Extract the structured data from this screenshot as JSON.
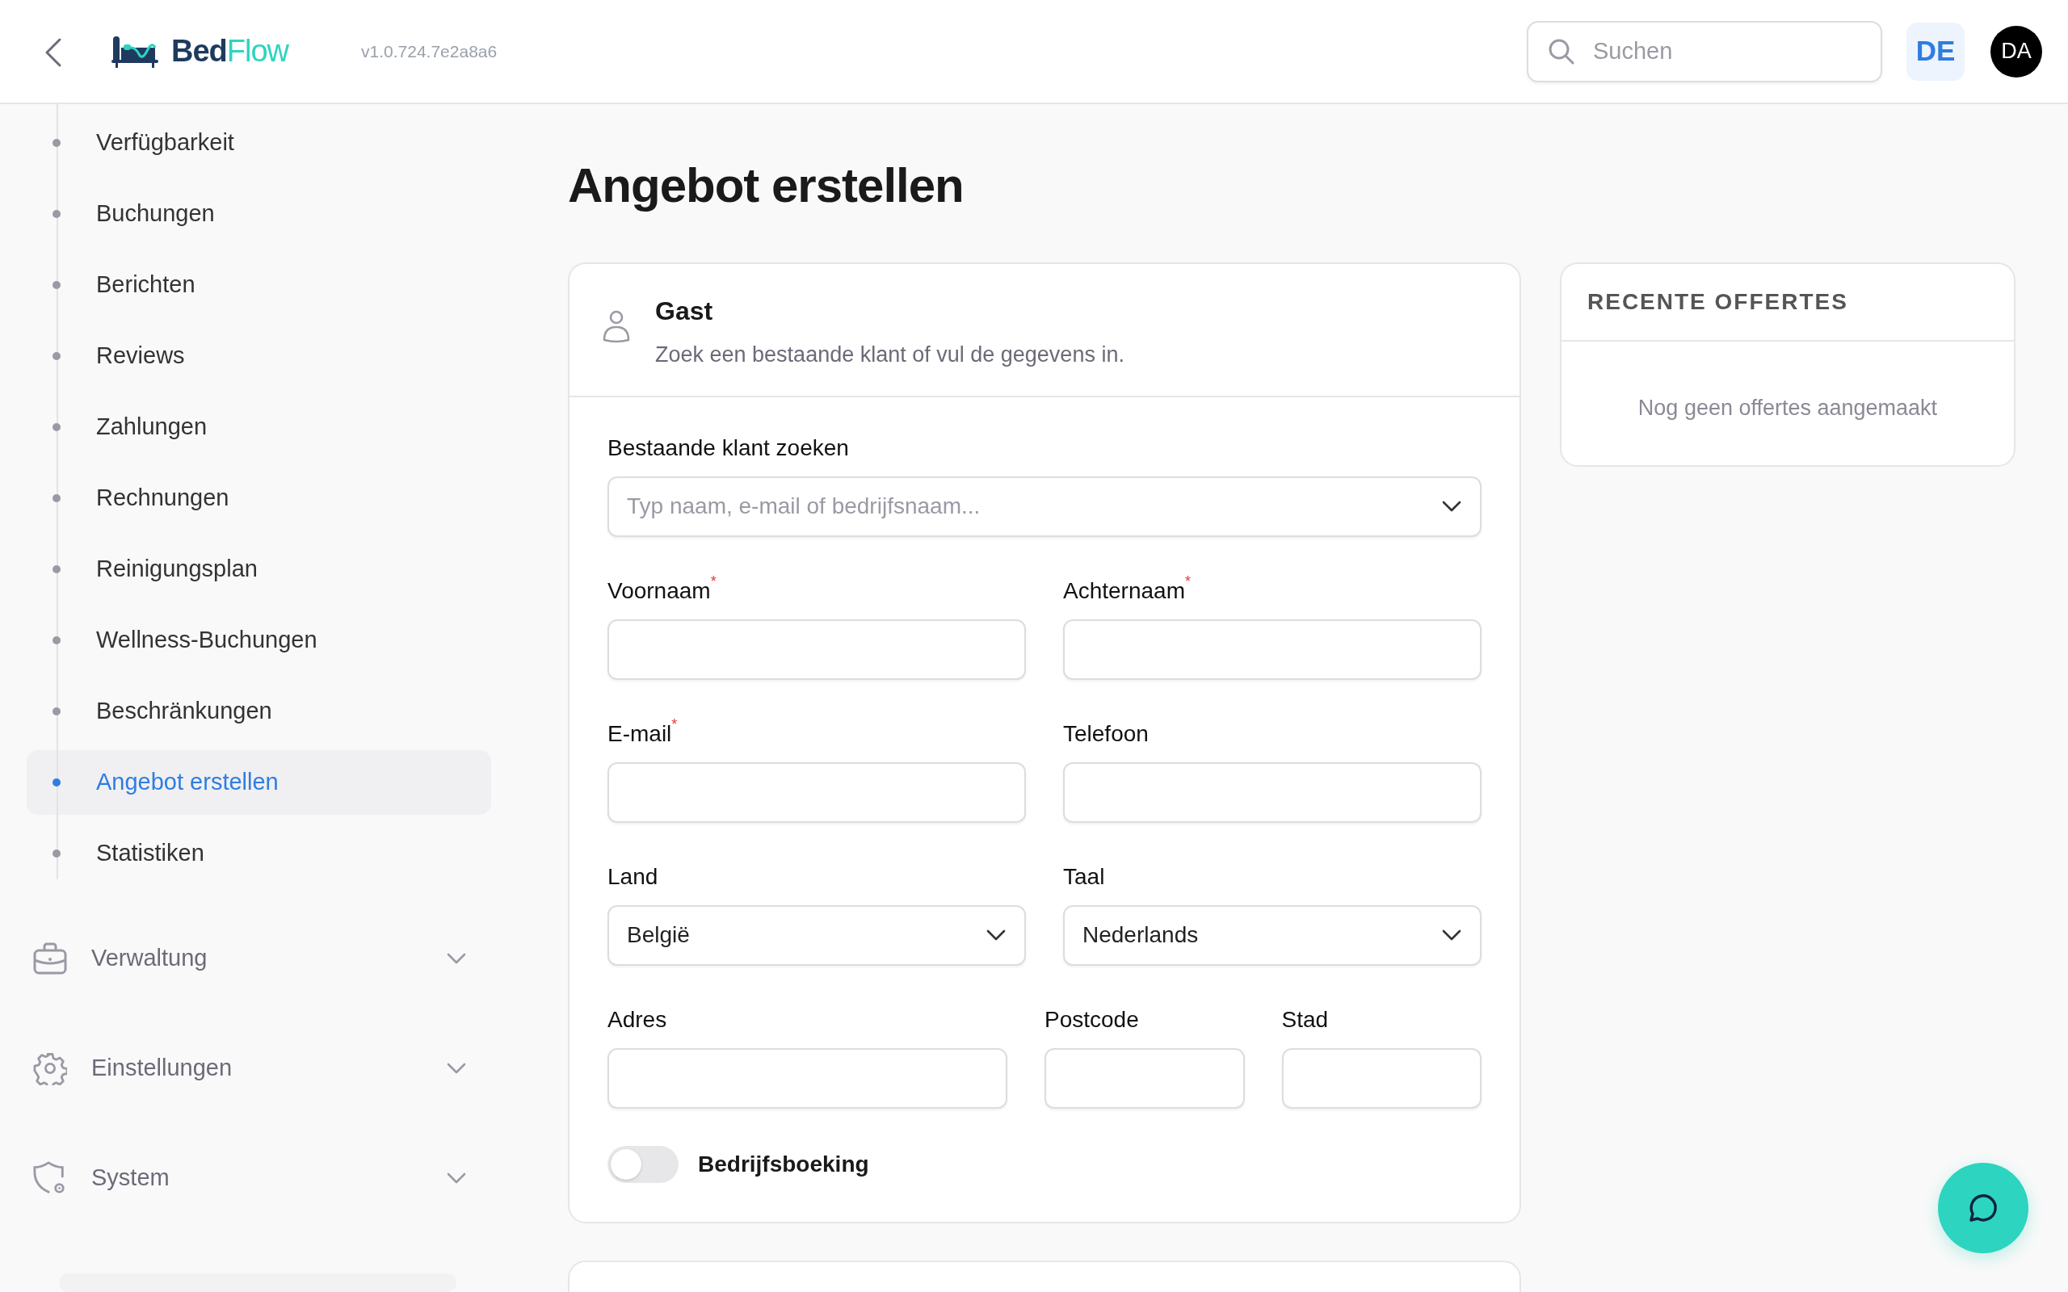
{
  "header": {
    "brand": {
      "part1": "Bed",
      "part2": "Flow"
    },
    "version": "v1.0.724.7e2a8a6",
    "search": {
      "placeholder": "Suchen"
    },
    "language": "DE",
    "avatar": "DA"
  },
  "sidebar": {
    "items": [
      {
        "label": "Verfügbarkeit",
        "selected": false
      },
      {
        "label": "Buchungen",
        "selected": false
      },
      {
        "label": "Berichten",
        "selected": false
      },
      {
        "label": "Reviews",
        "selected": false
      },
      {
        "label": "Zahlungen",
        "selected": false
      },
      {
        "label": "Rechnungen",
        "selected": false
      },
      {
        "label": "Reinigungsplan",
        "selected": false
      },
      {
        "label": "Wellness-Buchungen",
        "selected": false
      },
      {
        "label": "Beschränkungen",
        "selected": false
      },
      {
        "label": "Angebot erstellen",
        "selected": true
      },
      {
        "label": "Statistiken",
        "selected": false
      }
    ],
    "sections": [
      {
        "label": "Verwaltung",
        "kind": "briefcase",
        "expanded": false
      },
      {
        "label": "Einstellungen",
        "kind": "gear",
        "expanded": false
      },
      {
        "label": "System",
        "kind": "shield",
        "expanded": false
      }
    ]
  },
  "page_title": "Angebot erstellen",
  "guest_card": {
    "title": "Gast",
    "subtitle": "Zoek een bestaande klant of vul de gegevens in.",
    "rows": [
      [
        {
          "label": "Bestaande klant zoeken",
          "kind": "select",
          "placeholder": "Typ naam, e-mail of bedrijfsnaam..."
        }
      ],
      [
        {
          "label": "Voornaam$^{*}$",
          "kind": "text"
        },
        {
          "label": "Achternaam$^{*}$",
          "kind": "text"
        }
      ],
      [
        {
          "label": "E-mail$^{*}$",
          "kind": "text"
        },
        {
          "label": "Telefoon",
          "kind": "text"
        }
      ],
      [
        {
          "label": "Land",
          "kind": "select",
          "value": "België"
        },
        {
          "label": "Taal",
          "kind": "select",
          "value": "Nederlands"
        }
      ],
      [
        {
          "label": "Adres",
          "kind": "text"
        },
        {
          "label": "Postcode",
          "kind": "text"
        },
        {
          "label": "Stad",
          "kind": "text"
        }
      ]
    ],
    "toggle": {
      "label": "Bedrijfsboeking",
      "on": false
    }
  },
  "recent_offers": {
    "title": "RECENTE OFFERTES",
    "empty_text": "Nog geen offertes aangemaakt"
  }
}
